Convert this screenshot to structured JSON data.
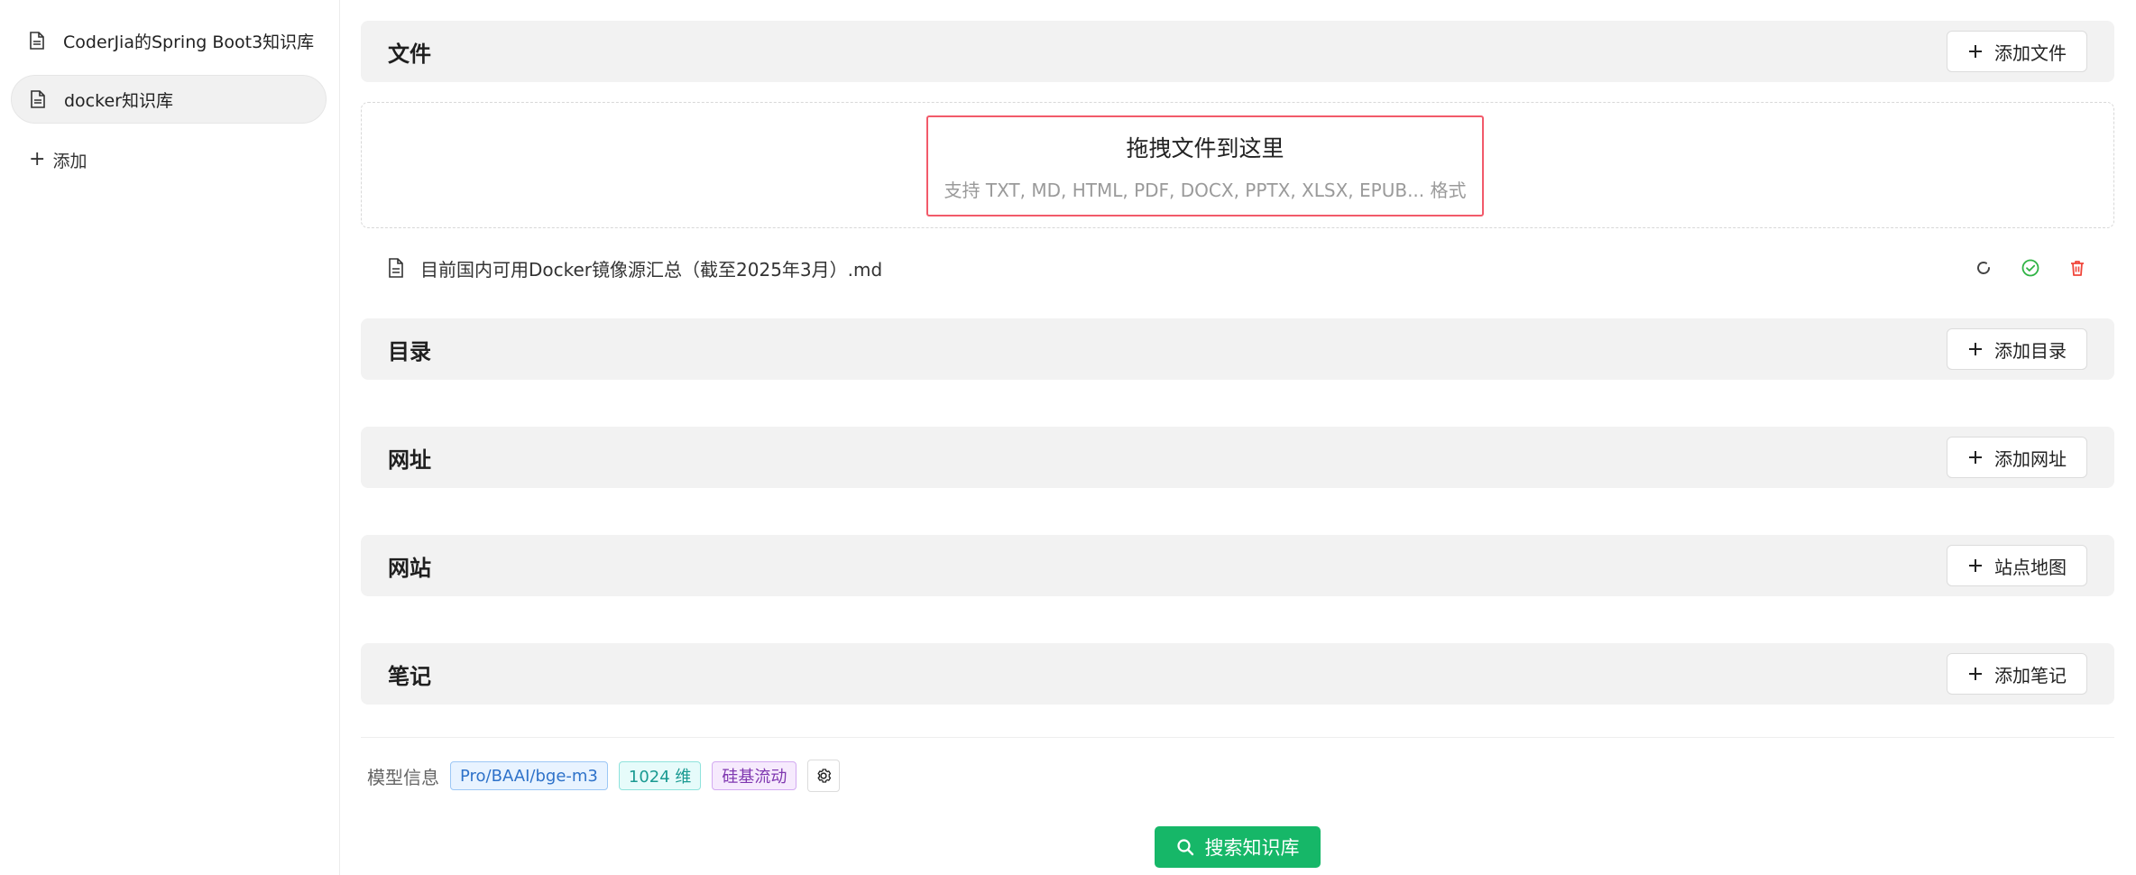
{
  "sidebar": {
    "items": [
      {
        "label": "CoderJia的Spring Boot3知识库",
        "active": false
      },
      {
        "label": "docker知识库",
        "active": true
      }
    ],
    "add_label": "添加"
  },
  "sections": {
    "files": {
      "title": "文件",
      "button": "添加文件"
    },
    "directory": {
      "title": "目录",
      "button": "添加目录"
    },
    "url": {
      "title": "网址",
      "button": "添加网址"
    },
    "website": {
      "title": "网站",
      "button": "站点地图"
    },
    "notes": {
      "title": "笔记",
      "button": "添加笔记"
    }
  },
  "dropzone": {
    "title": "拖拽文件到这里",
    "hint": "支持 TXT, MD, HTML, PDF, DOCX, PPTX, XLSX, EPUB... 格式"
  },
  "files": [
    {
      "name": "目前国内可用Docker镜像源汇总（截至2025年3月）.md"
    }
  ],
  "model_info": {
    "label": "模型信息",
    "tags": [
      "Pro/BAAI/bge-m3",
      "1024 维",
      "硅基流动"
    ]
  },
  "search_button": "搜索知识库",
  "colors": {
    "accent_green": "#16b768",
    "delete_red": "#f0453a",
    "success_green": "#2fb344",
    "drop_border": "#f25a6a"
  }
}
